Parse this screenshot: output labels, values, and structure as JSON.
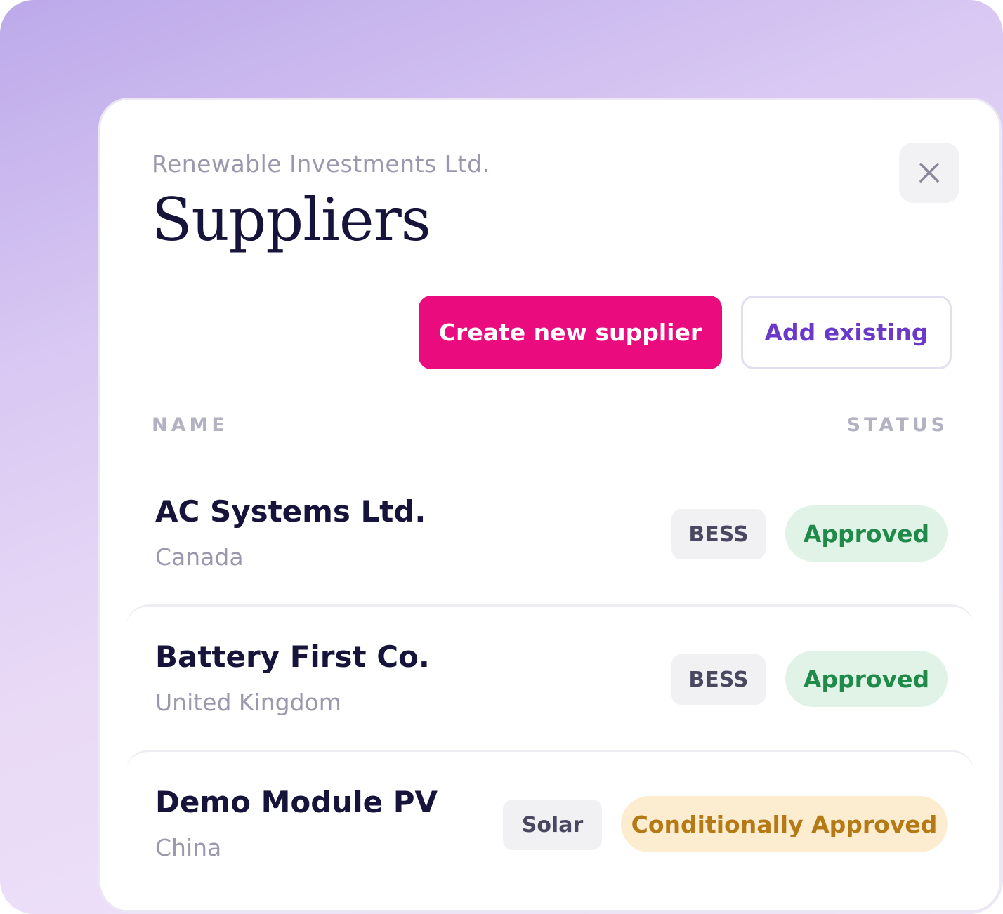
{
  "header": {
    "organization": "Renewable Investments Ltd.",
    "title": "Suppliers",
    "close_icon": "close-icon"
  },
  "actions": {
    "create_label": "Create new supplier",
    "add_existing_label": "Add existing"
  },
  "table": {
    "columns": {
      "name": "NAME",
      "status": "STATUS"
    },
    "rows": [
      {
        "name": "AC Systems Ltd.",
        "country": "Canada",
        "category": "BESS",
        "status": "Approved"
      },
      {
        "name": "Battery First Co.",
        "country": "United Kingdom",
        "category": "BESS",
        "status": "Approved"
      },
      {
        "name": "Demo Module PV",
        "country": "China",
        "category": "Solar",
        "status": "Conditionally Approved"
      }
    ]
  },
  "colors": {
    "primary": "#ea0c7e",
    "accent": "#6b39c9",
    "approved_bg": "#e0f3e6",
    "approved_text": "#1f8a4a",
    "conditional_bg": "#fcecd0",
    "conditional_text": "#b57a16"
  }
}
